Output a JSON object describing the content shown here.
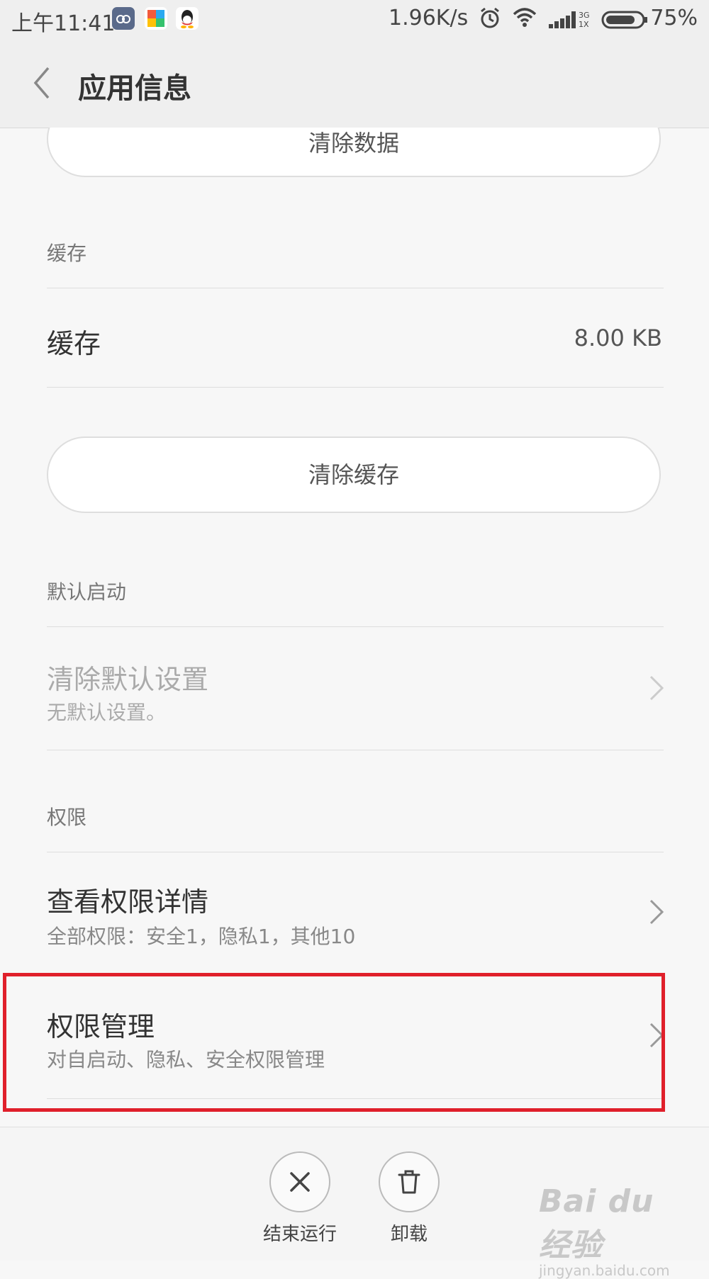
{
  "status_bar": {
    "time": "上午11:41",
    "net_speed": "1.96K/s",
    "network_label": "3G\n1X",
    "battery_percent": "75%",
    "icons": [
      "app-icon-1",
      "app-icon-2",
      "qq-icon",
      "alarm-icon",
      "wifi-icon",
      "signal-icon",
      "battery-icon"
    ]
  },
  "header": {
    "title": "应用信息"
  },
  "storage": {
    "clear_data_label": "清除数据"
  },
  "cache": {
    "section_label": "缓存",
    "row_label": "缓存",
    "row_value": "8.00 KB",
    "clear_cache_label": "清除缓存"
  },
  "default_launch": {
    "section_label": "默认启动",
    "title": "清除默认设置",
    "subtitle": "无默认设置。"
  },
  "permissions": {
    "section_label": "权限",
    "details_title": "查看权限详情",
    "details_subtitle": "全部权限：安全1，隐私1，其他10",
    "manage_title": "权限管理",
    "manage_subtitle": "对自启动、隐私、安全权限管理"
  },
  "bottom_bar": {
    "force_stop_label": "结束运行",
    "uninstall_label": "卸载"
  },
  "watermark": {
    "main": "Bai du 经验",
    "sub": "jingyan.baidu.com"
  },
  "colors": {
    "highlight": "#e0202b",
    "background": "#f7f7f7"
  }
}
